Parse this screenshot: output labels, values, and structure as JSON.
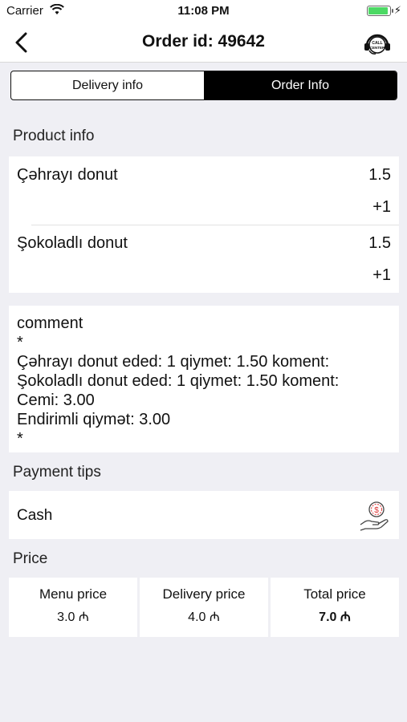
{
  "status_bar": {
    "carrier": "Carrier",
    "time": "11:08 PM"
  },
  "nav": {
    "title": "Order id: 49642",
    "call_icon_text": "CALL CENTER"
  },
  "tabs": [
    {
      "label": "Delivery info",
      "active": false
    },
    {
      "label": "Order Info",
      "active": true
    }
  ],
  "product_info": {
    "title": "Product info",
    "items": [
      {
        "name": "Çəhrayı donut",
        "price": "1.5",
        "qty": "+1"
      },
      {
        "name": "Şokoladlı donut",
        "price": "1.5",
        "qty": "+1"
      }
    ]
  },
  "comment": {
    "text": "comment\n*\nÇəhrayı donut eded: 1 qiymet: 1.50 koment:\nŞokoladlı donut eded: 1 qiymet: 1.50 koment:\nCemi: 3.00\nEndirimli qiymət: 3.00\n*"
  },
  "payment": {
    "title": "Payment tips",
    "method": "Cash",
    "icon": "cash-hand-icon"
  },
  "price": {
    "title": "Price",
    "menu": {
      "label": "Menu price",
      "value": "3.0 ₼"
    },
    "delivery": {
      "label": "Delivery price",
      "value": "4.0 ₼"
    },
    "total": {
      "label": "Total price",
      "value": "7.0 ₼"
    }
  },
  "colors": {
    "accent": "#000000",
    "background": "#efeff4",
    "battery": "#4cd964"
  }
}
